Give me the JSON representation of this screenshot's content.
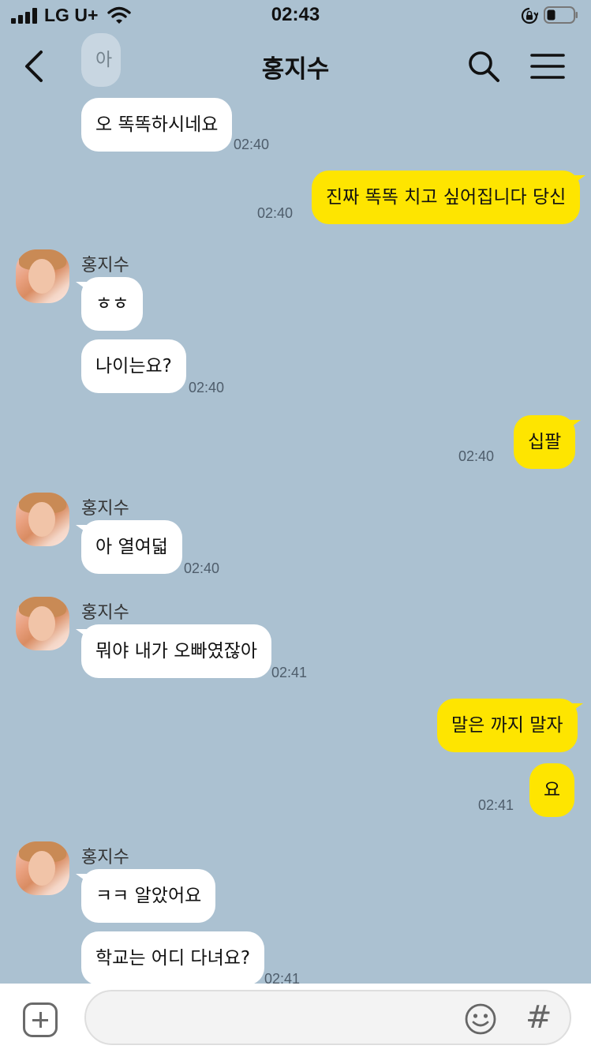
{
  "status_bar": {
    "carrier": "LG U+",
    "time": "02:43",
    "icons": [
      "signal-icon",
      "wifi-icon",
      "rotation-lock-icon",
      "battery-icon"
    ]
  },
  "header": {
    "title": "홍지수",
    "icons": [
      "back-icon",
      "search-icon",
      "menu-icon"
    ]
  },
  "messages": [
    {
      "from": "them",
      "text": "아"
    },
    {
      "from": "them",
      "text": "오 똑똑하시네요",
      "time": "02:40"
    },
    {
      "from": "me",
      "text": "진짜 똑똑 치고 싶어집니다 당신",
      "time": "02:40"
    },
    {
      "from": "them",
      "sender": "홍지수",
      "text": "ㅎㅎ"
    },
    {
      "from": "them",
      "text": "나이는요?",
      "time": "02:40"
    },
    {
      "from": "me",
      "text": "십팔",
      "time": "02:40"
    },
    {
      "from": "them",
      "sender": "홍지수",
      "text": "아 열여덟",
      "time": "02:40"
    },
    {
      "from": "them",
      "sender": "홍지수",
      "text": "뭐야 내가 오빠였잖아",
      "time": "02:41"
    },
    {
      "from": "me",
      "text": "말은 까지 말자"
    },
    {
      "from": "me",
      "text": "요",
      "time": "02:41"
    },
    {
      "from": "them",
      "sender": "홍지수",
      "text": "ㅋㅋ 알았어요"
    },
    {
      "from": "them",
      "text": "학교는 어디 다녀요?",
      "time": "02:41"
    }
  ],
  "input_bar": {
    "icons": [
      "plus-icon",
      "emoji-icon",
      "hashtag-icon"
    ],
    "hash_glyph": "#"
  },
  "colors": {
    "background": "#abc1d1",
    "my_bubble": "#fee500",
    "their_bubble": "#ffffff"
  }
}
